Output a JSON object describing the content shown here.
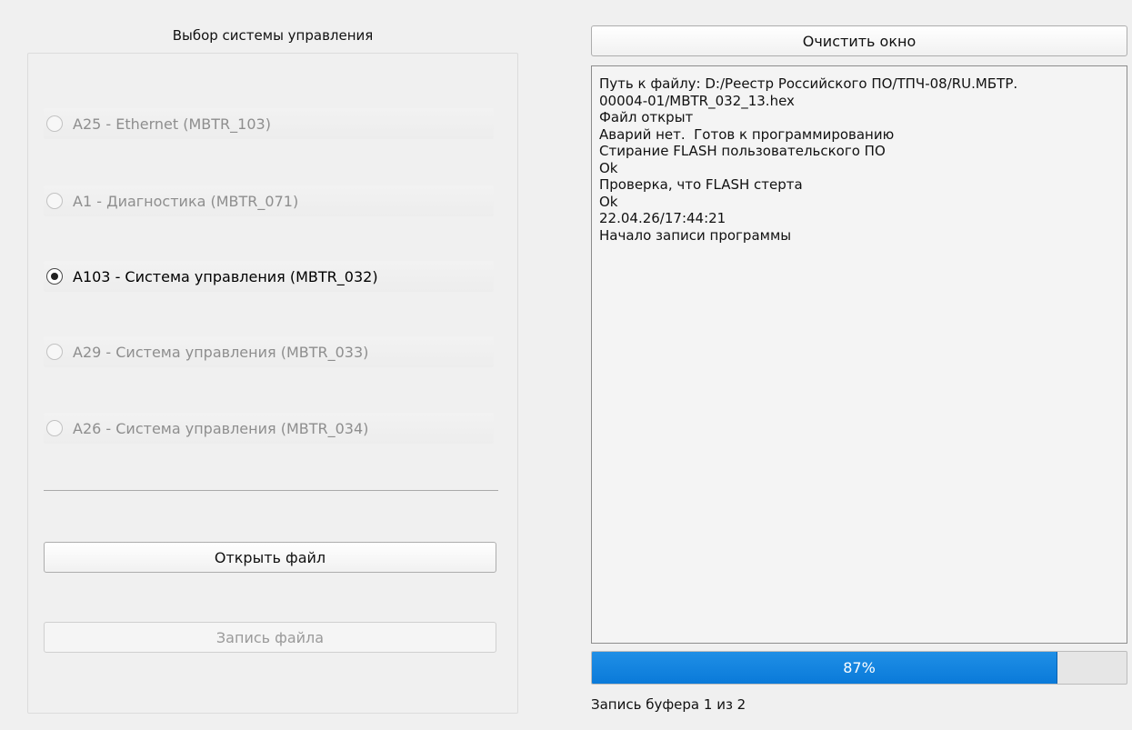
{
  "left_panel": {
    "title": "Выбор системы управления",
    "radios": [
      {
        "label": "A25 - Ethernet (MBTR_103)",
        "checked": false,
        "enabled": false
      },
      {
        "label": "A1 - Диагностика (MBTR_071)",
        "checked": false,
        "enabled": false
      },
      {
        "label": "A103 - Система управления (MBTR_032)",
        "checked": true,
        "enabled": true
      },
      {
        "label": "A29 - Система управления (MBTR_033)",
        "checked": false,
        "enabled": false
      },
      {
        "label": "A26 - Система управления (MBTR_034)",
        "checked": false,
        "enabled": false
      }
    ],
    "open_file_label": "Открыть файл",
    "write_file_label": "Запись файла"
  },
  "right_panel": {
    "clear_label": "Очистить окно",
    "log_lines": [
      "Путь к файлу: D:/Реестр Российского ПО/ТПЧ-08/RU.МБТР.",
      "00004-01/MBTR_032_13.hex",
      "Файл открыт",
      "Аварий нет.  Готов к программированию",
      "Стирание FLASH пользовательского ПО",
      "Ok",
      "Проверка, что FLASH стерта",
      "Ok",
      "22.04.26/17:44:21",
      "Начало записи программы"
    ],
    "progress": {
      "value": 87,
      "text": "87%",
      "color": "#0f83e0"
    },
    "status": "Запись буфера 1 из 2"
  }
}
